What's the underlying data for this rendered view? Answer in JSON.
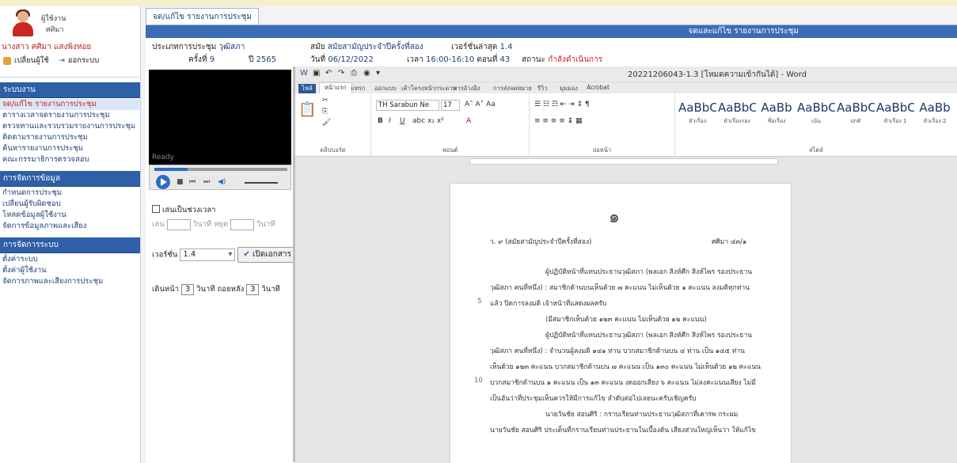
{
  "user": {
    "role_label": "ผู้ใช้งาน",
    "username": "ศศิมา",
    "full_name": "นางสาว ศศิมา แสงพิงห่อย",
    "change_user_label": "เปลี่ยนผู้ใช้",
    "logout_label": "ออกระบบ"
  },
  "sidebar": {
    "sections": [
      {
        "title": "ระบบงาน",
        "items": [
          "จด/แก้ไข รายงานการประชุม",
          "ตารางเวลาจดรายงานการประชุม",
          "ตรวจทานและรวบรวมรายงานการประชุม",
          "ติดตามรายงานการประชุม",
          "ค้นหารายงานการประชุม",
          "คณะกรรมาธิการตรวจสอบ"
        ]
      },
      {
        "title": "การจัดการข้อมูล",
        "items": [
          "กำหนดการประชุม",
          "เปลี่ยนผู้รับผิดชอบ",
          "โหลดข้อมูลผู้ใช้งาน",
          "จัดการข้อมูลภาพและเสียง"
        ]
      },
      {
        "title": "การจัดการระบบ",
        "items": [
          "ตั้งค่าระบบ",
          "ตั้งค่าผู้ใช้งาน",
          "จัดการภาพและเสียงการประชุม"
        ]
      }
    ]
  },
  "tab": {
    "label": "จด/แก้ไข รายงานการประชุม"
  },
  "content": {
    "title": "จดและแก้ไข รายงานการประชุม",
    "meeting_type_label": "ประเภทการประชุม",
    "meeting_type": "วุฒิสภา",
    "session_label": "สมัย",
    "session": "สมัยสามัญประจำปีครั้งที่สอง",
    "latest_version_label": "เวอร์ชั่นล่าสุด",
    "latest_version": "1.4",
    "time_no_label": "ครั้งที่",
    "time_no": "9",
    "year_label": "ปี",
    "year": "2565",
    "date_label": "วันที่",
    "date": "06/12/2022",
    "time_label": "เวลา",
    "time": "16:00-16:10",
    "round_label": "ตอนที่",
    "round": "43",
    "status_label": "สถานะ",
    "status": "กำลังดำเนินการ"
  },
  "player": {
    "status": "Ready",
    "progress": 0.25
  },
  "controls": {
    "play_range_label": "เล่นเป็นช่วงเวลา",
    "play_label": "เล่น",
    "second_label": "วินาที",
    "stop_label": "หยุด",
    "version_label": "เวอร์ชั่น",
    "version_value": "1.4",
    "open_doc_label": "เปิดเอกสาร",
    "back_label": "เดินหน้า",
    "back_value": "3",
    "seconds_label": "วินาที",
    "forward_label": "ถอยหลัง",
    "forward_value": "3"
  },
  "word": {
    "title": "20221206043-1.3 [โหมดความเข้ากันได้] - Word",
    "tabs": [
      "ไฟล์",
      "หน้าแรก",
      "แทรก",
      "ออกแบบ",
      "เค้าโครงหน้ากระดาษ",
      "การอ้างอิง",
      "การส่งจดหมาย",
      "รีวิว",
      "มุมมอง",
      "Acrobat"
    ],
    "font_name": "TH Sarabun Ne",
    "font_size": "17",
    "groups": [
      "คลิปบอร์ด",
      "ฟอนต์",
      "ย่อหน้า",
      "สไตล์"
    ],
    "styles": [
      {
        "sample": "AaBbC",
        "label": "หัวเรื่อง"
      },
      {
        "sample": "AaBbCcD",
        "label": "หัวเรื่องรอง"
      },
      {
        "sample": "AaBb",
        "label": "ชื่อเรื่อง"
      },
      {
        "sample": "AaBbC",
        "label": "เน้น"
      },
      {
        "sample": "AaBbCcD",
        "label": "ปกติ"
      },
      {
        "sample": "AaBbC",
        "label": "หัวเรื่อง 1"
      },
      {
        "sample": "AaBb",
        "label": "หัวเรื่อง 2"
      }
    ]
  },
  "document": {
    "page_number": "๑",
    "header_left": "ว. ๙ (สมัยสามัญประจำปีครั้งที่สอง)",
    "header_right": "ศศิมา ๔๓/๑",
    "lines": [
      "ผู้ปฏิบัติหน้าที่แทนประธานวุฒิสภา (พลเอก สิงห์ศึก สิงห์ไพร รองประธาน",
      "วุฒิสภา คนที่หนึ่ง) : สมาชิกด้านบนเห็นด้วย ๗ คะแนน ไม่เห็นด้วย ๑ คะแนน ลงมติทุกท่าน",
      "แล้ว ปิดการลงมติ เจ้าหน้าที่แสดงผลครับ",
      "(มีสมาชิกเห็นด้วย ๑๒๓ คะแนน ไม่เห็นด้วย ๑๒ คะแนน)",
      "ผู้ปฏิบัติหน้าที่แทนประธานวุฒิสภา (พลเอก สิงห์ศึก สิงห์ไพร รองประธาน",
      "วุฒิสภา คนที่หนึ่ง) : จำนวนผู้ลงมติ ๑๔๑ ท่าน บวกสมาชิกด้านบน ๔ ท่าน เป็น ๑๔๕ ท่าน",
      "เห็นด้วย ๑๒๓ คะแนน บวกสมาชิกด้านบน ๗ คะแนน เป็น ๑๓๐ คะแนน ไม่เห็นด้วย ๑๒ คะแนน",
      "บวกสมาชิกด้านบน ๑ คะแนน เป็น ๑๓ คะแนน งดออกเสียง ๖ คะแนน ไม่ลงคะแนนเสียง ไม่มี",
      "เป็นอันว่าที่ประชุมเห็นควรให้มีการแก้ไข ลำดับต่อไปเลยนะครับเชิญครับ",
      "นายวันชัย สอนศิริ : กราบเรียนท่านประธานวุฒิสภาที่เคารพ กระผม",
      "นายวันชัย สอนศิริ ประเด็นที่กราบเรียนท่านประธานในเบื้องต้น เสียงส่วนใหญ่เห็นว่า ให้แก้ไข"
    ],
    "line_numbers": [
      "5",
      "10"
    ]
  }
}
